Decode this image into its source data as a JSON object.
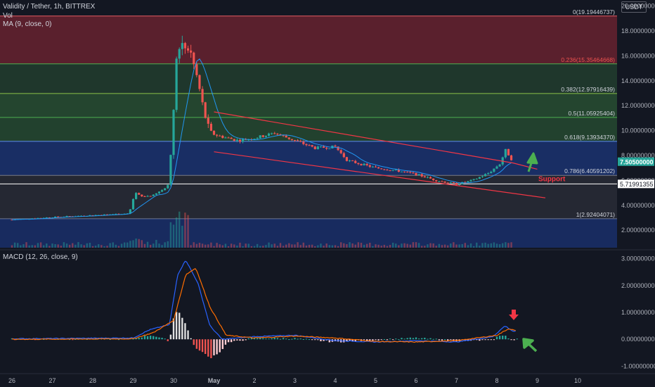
{
  "header": {
    "symbol_line": "Validity / Tether, 1h, BITTREX",
    "vol_label": "Vol",
    "ma_label": "MA (9, close, 0)",
    "macd_label": "MACD (12, 26, close, 9)",
    "currency": "USDT"
  },
  "colors": {
    "background": "#131722",
    "up": "#26a69a",
    "down": "#ef5350",
    "ma": "#2196f3",
    "macd_line": "#2962ff",
    "signal_line": "#ff6d00",
    "channel": "#f23645",
    "arrow_up": "#4caf50",
    "arrow_down": "#f23645"
  },
  "chart_data": [
    {
      "type": "candlestick",
      "title": "Validity / Tether, 1h, BITTREX",
      "x_ticks": [
        "26",
        "27",
        "28",
        "29",
        "30",
        "May",
        "2",
        "3",
        "4",
        "5",
        "6",
        "7",
        "8",
        "9",
        "10"
      ],
      "y_ticks": [
        "2.00000000",
        "4.00000000",
        "6.00000000",
        "8.00000000",
        "10.00000000",
        "12.00000000",
        "14.00000000",
        "16.00000000",
        "18.00000000",
        "20.00000000"
      ],
      "ylim": [
        0.6,
        20.2
      ],
      "grid": false,
      "last_price": "7.50500000",
      "support_price": "5.71991355",
      "support_label": "Support",
      "fib_levels": [
        {
          "label": "0(19.19446737)",
          "value": 19.19446737
        },
        {
          "label": "0.236(15.35464668)",
          "value": 15.35464668
        },
        {
          "label": "0.382(12.97916439)",
          "value": 12.97916439
        },
        {
          "label": "0.5(11.05925404)",
          "value": 11.05925404
        },
        {
          "label": "0.618(9.13934370)",
          "value": 9.1393437
        },
        {
          "label": "0.786(6.40591202)",
          "value": 6.40591202
        },
        {
          "label": "1(2.92404071)",
          "value": 2.92404071
        }
      ],
      "series_approx_close": [
        {
          "day": 0.0,
          "close": 2.85
        },
        {
          "day": 1.0,
          "close": 3.05
        },
        {
          "day": 2.0,
          "close": 3.2
        },
        {
          "day": 2.9,
          "close": 3.35
        },
        {
          "day": 3.05,
          "close": 5.0
        },
        {
          "day": 3.2,
          "close": 4.7
        },
        {
          "day": 3.5,
          "close": 4.8
        },
        {
          "day": 3.85,
          "close": 5.5
        },
        {
          "day": 3.95,
          "close": 8.5
        },
        {
          "day": 4.05,
          "close": 15.5
        },
        {
          "day": 4.2,
          "close": 17.2
        },
        {
          "day": 4.4,
          "close": 16.5
        },
        {
          "day": 4.6,
          "close": 14.0
        },
        {
          "day": 4.75,
          "close": 11.5
        },
        {
          "day": 4.9,
          "close": 9.8
        },
        {
          "day": 5.2,
          "close": 9.5
        },
        {
          "day": 5.6,
          "close": 9.2
        },
        {
          "day": 6.0,
          "close": 9.4
        },
        {
          "day": 6.5,
          "close": 9.8
        },
        {
          "day": 7.0,
          "close": 9.2
        },
        {
          "day": 7.5,
          "close": 8.6
        },
        {
          "day": 8.0,
          "close": 8.7
        },
        {
          "day": 8.3,
          "close": 7.6
        },
        {
          "day": 9.0,
          "close": 7.0
        },
        {
          "day": 9.5,
          "close": 6.8
        },
        {
          "day": 10.0,
          "close": 6.5
        },
        {
          "day": 10.5,
          "close": 6.0
        },
        {
          "day": 11.0,
          "close": 5.7
        },
        {
          "day": 11.4,
          "close": 6.0
        },
        {
          "day": 11.8,
          "close": 6.6
        },
        {
          "day": 12.1,
          "close": 7.4
        },
        {
          "day": 12.2,
          "close": 8.5
        },
        {
          "day": 12.4,
          "close": 7.5
        }
      ],
      "channel": {
        "upper": [
          [
            5.0,
            11.5
          ],
          [
            12.4,
            7.4
          ],
          [
            13.0,
            6.9
          ]
        ],
        "lower": [
          [
            5.0,
            8.3
          ],
          [
            13.2,
            4.6
          ]
        ]
      }
    },
    {
      "type": "macd",
      "title": "MACD (12, 26, close, 9)",
      "y_ticks": [
        "3.00000000",
        "2.00000000",
        "1.00000000",
        "0.00000000",
        "-1.00000000"
      ],
      "ylim": [
        -1.25,
        3.25
      ],
      "macd_approx": [
        {
          "day": 0,
          "value": 0.02
        },
        {
          "day": 3,
          "value": 0.05
        },
        {
          "day": 3.4,
          "value": 0.35
        },
        {
          "day": 3.9,
          "value": 0.55
        },
        {
          "day": 4.1,
          "value": 2.4
        },
        {
          "day": 4.3,
          "value": 2.95
        },
        {
          "day": 4.6,
          "value": 2.1
        },
        {
          "day": 4.9,
          "value": 0.5
        },
        {
          "day": 5.2,
          "value": 0.0
        },
        {
          "day": 6.0,
          "value": 0.1
        },
        {
          "day": 7.0,
          "value": 0.15
        },
        {
          "day": 8.0,
          "value": -0.05
        },
        {
          "day": 9.0,
          "value": -0.1
        },
        {
          "day": 10.0,
          "value": -0.05
        },
        {
          "day": 11.0,
          "value": -0.1
        },
        {
          "day": 11.9,
          "value": 0.1
        },
        {
          "day": 12.2,
          "value": 0.5
        },
        {
          "day": 12.4,
          "value": 0.3
        }
      ],
      "signal_approx": [
        {
          "day": 0,
          "value": 0.0
        },
        {
          "day": 3,
          "value": 0.02
        },
        {
          "day": 3.5,
          "value": 0.25
        },
        {
          "day": 4.0,
          "value": 0.7
        },
        {
          "day": 4.3,
          "value": 2.4
        },
        {
          "day": 4.55,
          "value": 2.65
        },
        {
          "day": 4.9,
          "value": 1.2
        },
        {
          "day": 5.3,
          "value": 0.15
        },
        {
          "day": 6.0,
          "value": 0.05
        },
        {
          "day": 7.0,
          "value": 0.12
        },
        {
          "day": 8.0,
          "value": 0.05
        },
        {
          "day": 9.0,
          "value": -0.08
        },
        {
          "day": 10.0,
          "value": -0.1
        },
        {
          "day": 11.0,
          "value": -0.05
        },
        {
          "day": 12.0,
          "value": 0.15
        },
        {
          "day": 12.3,
          "value": 0.4
        },
        {
          "day": 12.5,
          "value": 0.3
        }
      ]
    }
  ]
}
